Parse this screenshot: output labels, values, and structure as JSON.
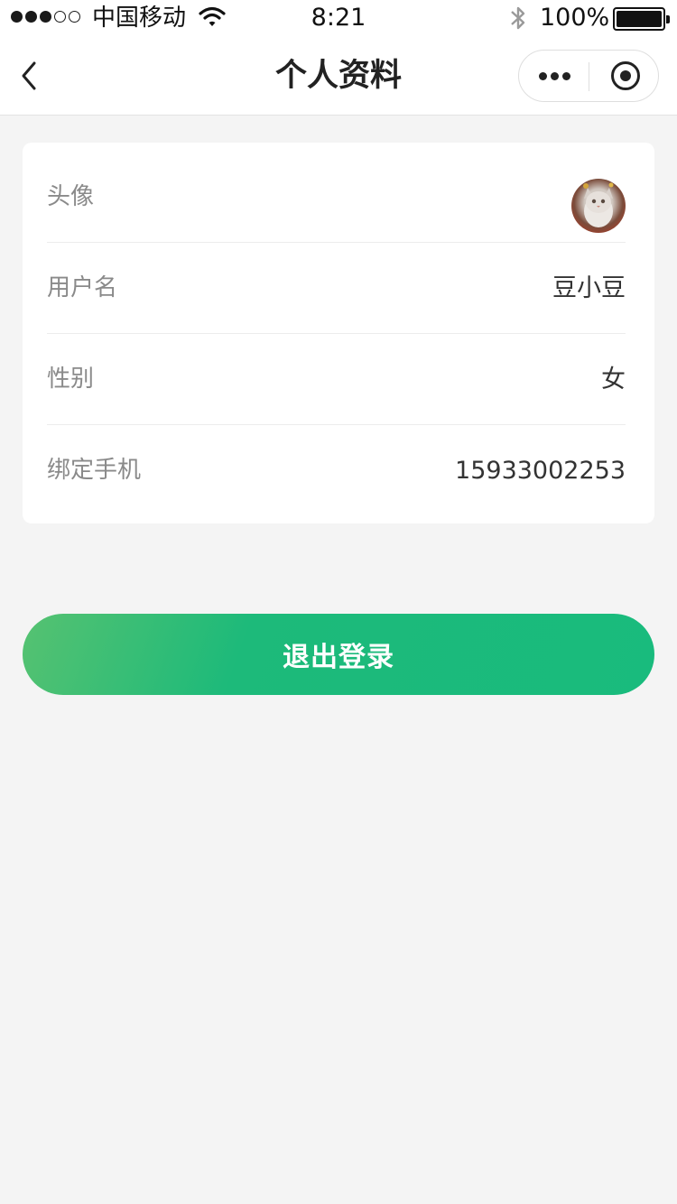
{
  "status_bar": {
    "signal_bars_filled": 3,
    "signal_bars_total": 5,
    "carrier": "中国移动",
    "time": "8:21",
    "battery_percent": "100%"
  },
  "nav": {
    "title": "个人资料"
  },
  "profile": {
    "avatar_label": "头像",
    "username_label": "用户名",
    "username_value": "豆小豆",
    "gender_label": "性别",
    "gender_value": "女",
    "phone_label": "绑定手机",
    "phone_value": "15933002253"
  },
  "actions": {
    "logout_label": "退出登录"
  },
  "colors": {
    "accent": "#19bb7d",
    "background": "#f4f4f4"
  }
}
